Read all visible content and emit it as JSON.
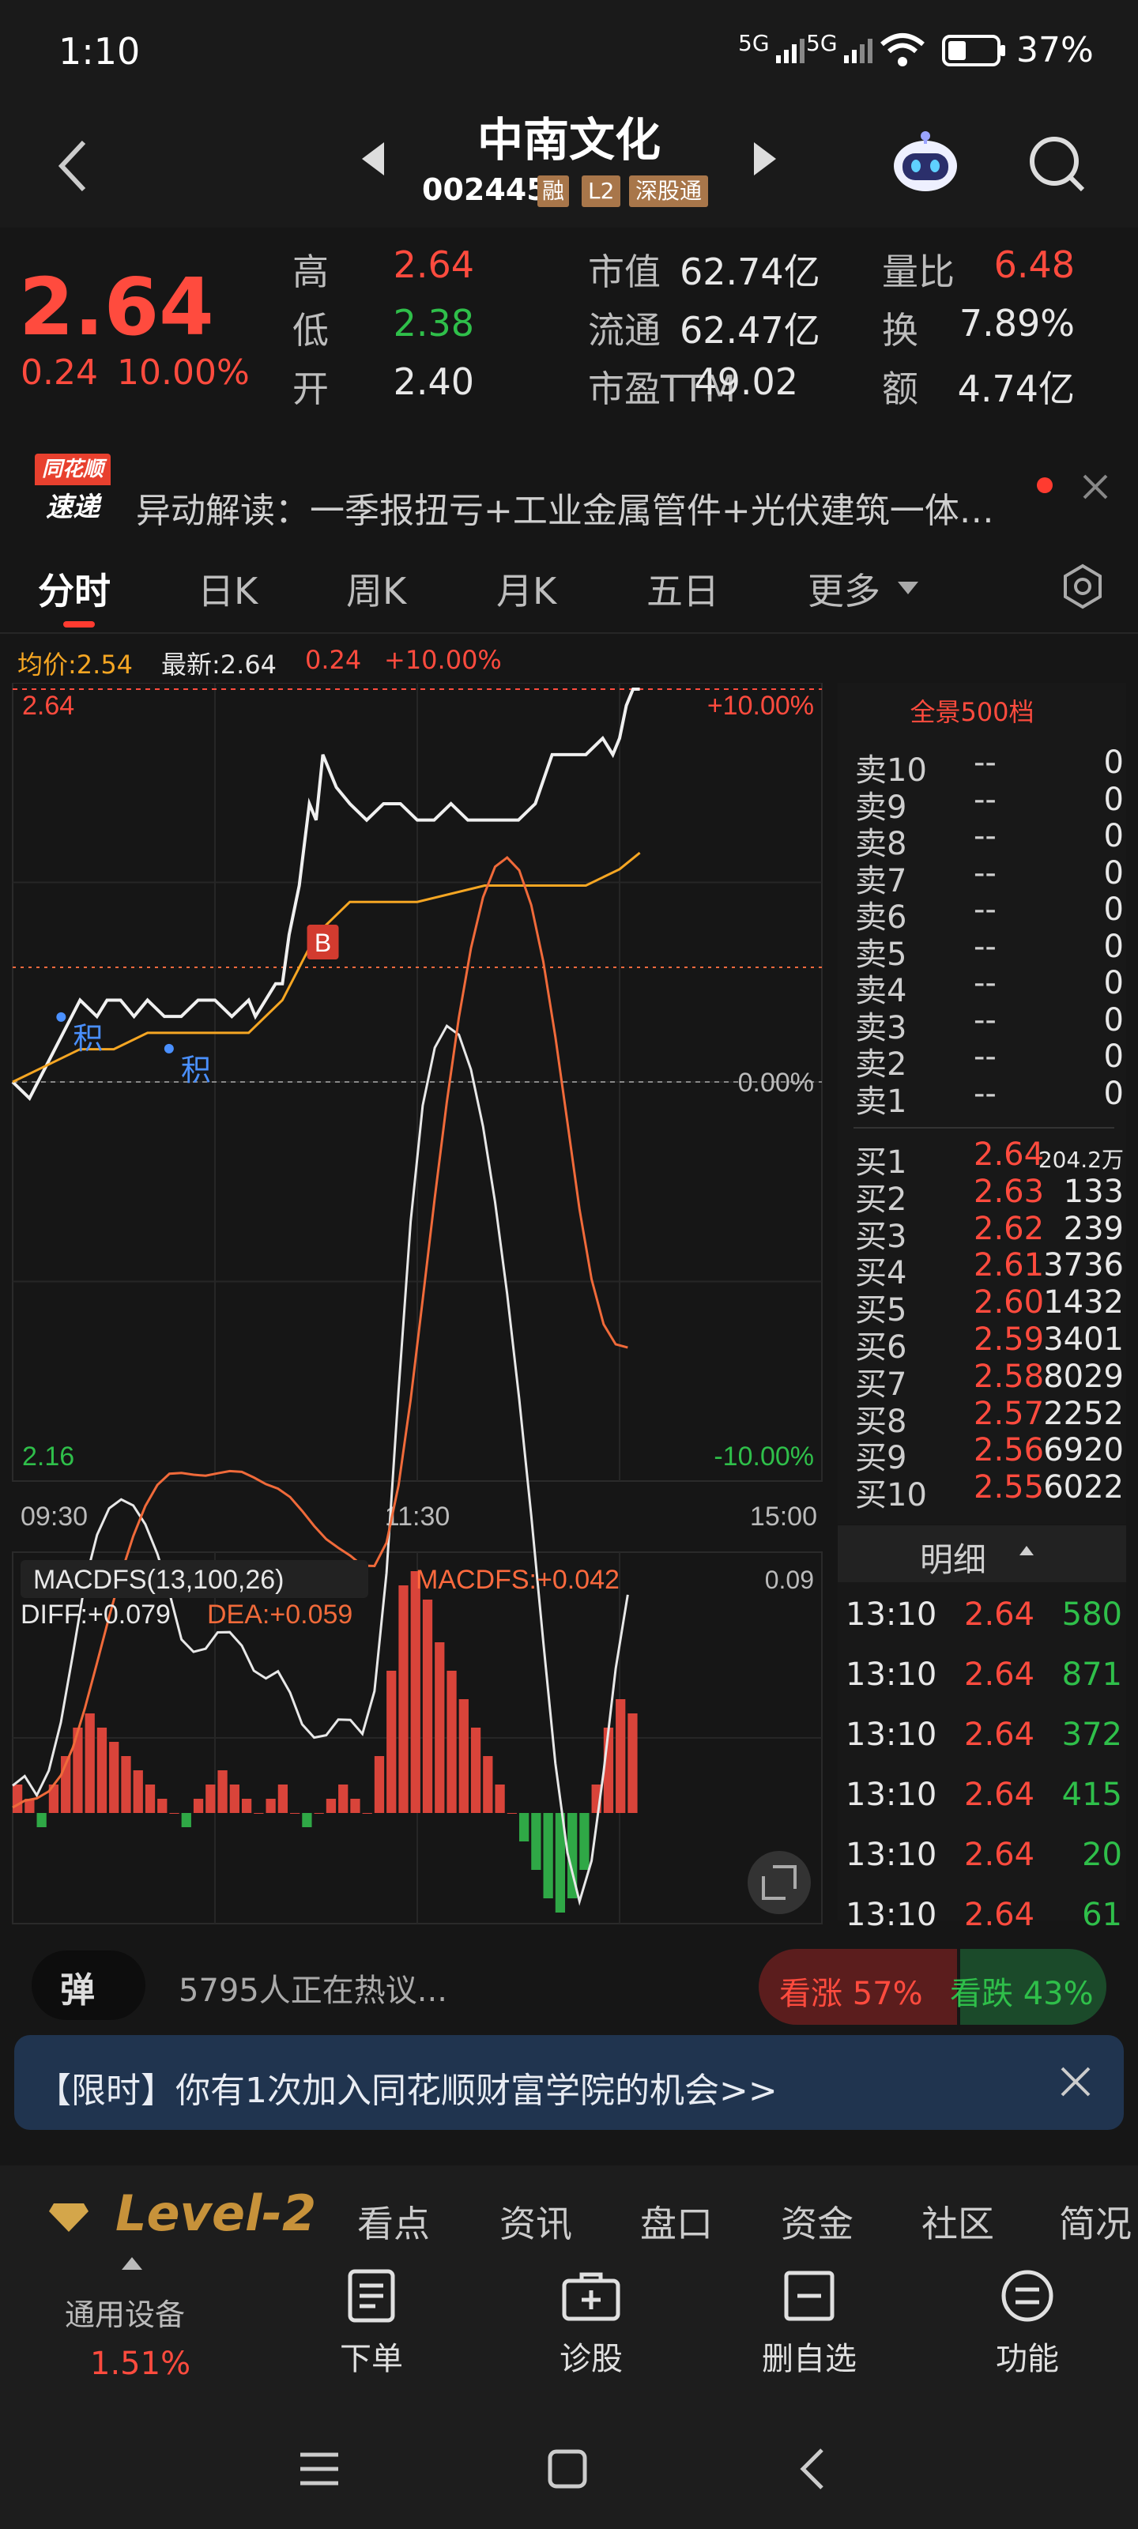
{
  "status": {
    "time": "1:10",
    "signal1": "5G",
    "signal2": "5G",
    "battery_pct": "37%"
  },
  "header": {
    "title": "中南文化",
    "code": "002445",
    "badges": [
      "融",
      "L2",
      "深股通"
    ]
  },
  "quote": {
    "price": "2.64",
    "change": "0.24",
    "change_pct": "10.00%",
    "stats": [
      {
        "label": "高",
        "value": "2.64",
        "color": "red"
      },
      {
        "label": "低",
        "value": "2.38",
        "color": "green"
      },
      {
        "label": "开",
        "value": "2.40",
        "color": "white"
      },
      {
        "label": "市值",
        "value": "62.74亿",
        "color": "white"
      },
      {
        "label": "流通",
        "value": "62.47亿",
        "color": "white"
      },
      {
        "label": "市盈TTM",
        "value": "49.02",
        "color": "white"
      },
      {
        "label": "量比",
        "value": "6.48",
        "color": "red"
      },
      {
        "label": "换",
        "value": "7.89%",
        "color": "white"
      },
      {
        "label": "额",
        "value": "4.74亿",
        "color": "white"
      }
    ]
  },
  "news": {
    "logo_top": "同花顺",
    "logo_bottom": "速递",
    "text": "异动解读：一季报扭亏+工业金属管件+光伏建筑一体…"
  },
  "tabs": [
    "分时",
    "日K",
    "周K",
    "月K",
    "五日",
    "更多"
  ],
  "chart_info": {
    "avg_label": "均价:2.54",
    "latest_label": "最新:2.64",
    "change": "0.24",
    "change_pct": "+10.00%"
  },
  "chart_data": {
    "type": "line",
    "title": "",
    "xlabel": "",
    "ylabel": "",
    "x_ticks": [
      "09:30",
      "11:30",
      "15:00"
    ],
    "y_left": {
      "top": "2.64",
      "bottom": "2.16"
    },
    "y_right": {
      "top": "+10.00%",
      "mid": "0.00%",
      "bottom": "-10.00%"
    },
    "ylim": [
      2.16,
      2.64
    ],
    "prev_close": 2.4,
    "series": [
      {
        "name": "price",
        "color": "#f0f0f0",
        "x": [
          0,
          5,
          10,
          15,
          20,
          25,
          28,
          32,
          36,
          40,
          45,
          50,
          55,
          60,
          65,
          70,
          72,
          75,
          78,
          80,
          82,
          85,
          88,
          90,
          92,
          94,
          96,
          100,
          105,
          110,
          115,
          120,
          125,
          130,
          135,
          140,
          145,
          150,
          155,
          160,
          165,
          170,
          175,
          178,
          180,
          182,
          184,
          186
        ],
        "values": [
          2.4,
          2.39,
          2.41,
          2.43,
          2.45,
          2.44,
          2.45,
          2.45,
          2.44,
          2.45,
          2.44,
          2.44,
          2.45,
          2.45,
          2.44,
          2.45,
          2.44,
          2.45,
          2.46,
          2.46,
          2.49,
          2.52,
          2.57,
          2.56,
          2.6,
          2.59,
          2.58,
          2.57,
          2.56,
          2.57,
          2.57,
          2.56,
          2.56,
          2.57,
          2.56,
          2.56,
          2.56,
          2.56,
          2.57,
          2.6,
          2.6,
          2.6,
          2.61,
          2.6,
          2.61,
          2.63,
          2.64,
          2.64
        ]
      },
      {
        "name": "avg",
        "color": "#f5a623",
        "x": [
          0,
          10,
          20,
          30,
          40,
          50,
          60,
          70,
          80,
          85,
          90,
          95,
          100,
          120,
          140,
          160,
          170,
          180,
          186
        ],
        "values": [
          2.4,
          2.41,
          2.42,
          2.42,
          2.43,
          2.43,
          2.43,
          2.43,
          2.45,
          2.47,
          2.49,
          2.5,
          2.51,
          2.51,
          2.52,
          2.52,
          2.52,
          2.53,
          2.54
        ]
      }
    ],
    "markers": [
      {
        "label": "B",
        "x": 92
      },
      {
        "label": "积",
        "x": 20
      },
      {
        "label": "积",
        "x": 52
      }
    ],
    "macd": {
      "title": "MACDFS(13,100,26)",
      "macdfs": "MACDFS:+0.042",
      "diff": "DIFF:+0.079",
      "dea": "DEA:+0.059",
      "max": "0.09",
      "bars": [
        0.01,
        0.005,
        -0.005,
        0.01,
        0.02,
        0.03,
        0.035,
        0.03,
        0.025,
        0.02,
        0.015,
        0.01,
        0.005,
        0.0,
        -0.005,
        0.005,
        0.01,
        0.015,
        0.01,
        0.005,
        0.0,
        0.005,
        0.01,
        0.0,
        -0.005,
        0.0,
        0.005,
        0.01,
        0.005,
        0.0,
        0.02,
        0.05,
        0.08,
        0.085,
        0.075,
        0.06,
        0.05,
        0.04,
        0.03,
        0.02,
        0.01,
        0.0,
        -0.01,
        -0.02,
        -0.03,
        -0.035,
        -0.03,
        -0.02,
        0.01,
        0.03,
        0.04,
        0.035
      ]
    }
  },
  "order_book": {
    "title": "全景500档",
    "asks": [
      {
        "label": "卖10",
        "price": "--",
        "vol": "0"
      },
      {
        "label": "卖9",
        "price": "--",
        "vol": "0"
      },
      {
        "label": "卖8",
        "price": "--",
        "vol": "0"
      },
      {
        "label": "卖7",
        "price": "--",
        "vol": "0"
      },
      {
        "label": "卖6",
        "price": "--",
        "vol": "0"
      },
      {
        "label": "卖5",
        "price": "--",
        "vol": "0"
      },
      {
        "label": "卖4",
        "price": "--",
        "vol": "0"
      },
      {
        "label": "卖3",
        "price": "--",
        "vol": "0"
      },
      {
        "label": "卖2",
        "price": "--",
        "vol": "0"
      },
      {
        "label": "卖1",
        "price": "--",
        "vol": "0"
      }
    ],
    "bids": [
      {
        "label": "买1",
        "price": "2.64",
        "vol": "204.2万"
      },
      {
        "label": "买2",
        "price": "2.63",
        "vol": "133"
      },
      {
        "label": "买3",
        "price": "2.62",
        "vol": "239"
      },
      {
        "label": "买4",
        "price": "2.61",
        "vol": "3736"
      },
      {
        "label": "买5",
        "price": "2.60",
        "vol": "1432"
      },
      {
        "label": "买6",
        "price": "2.59",
        "vol": "3401"
      },
      {
        "label": "买7",
        "price": "2.58",
        "vol": "8029"
      },
      {
        "label": "买8",
        "price": "2.57",
        "vol": "2252"
      },
      {
        "label": "买9",
        "price": "2.56",
        "vol": "6920"
      },
      {
        "label": "买10",
        "price": "2.55",
        "vol": "6022"
      }
    ]
  },
  "detail": {
    "title": "明细",
    "rows": [
      {
        "time": "13:10",
        "price": "2.64",
        "vol": "580"
      },
      {
        "time": "13:10",
        "price": "2.64",
        "vol": "871"
      },
      {
        "time": "13:10",
        "price": "2.64",
        "vol": "372"
      },
      {
        "time": "13:10",
        "price": "2.64",
        "vol": "415"
      },
      {
        "time": "13:10",
        "price": "2.64",
        "vol": "20"
      },
      {
        "time": "13:10",
        "price": "2.64",
        "vol": "61"
      }
    ]
  },
  "hot": {
    "badge": "弹",
    "text": "5795人正在热议...",
    "up": "看涨 57%",
    "down": "看跌 43%",
    "up_ratio": 0.57
  },
  "promo": {
    "text": "【限时】你有1次加入同花顺财富学院的机会>>"
  },
  "bottom_tabs": {
    "level2": "Level-2",
    "items": [
      "看点",
      "资讯",
      "盘口",
      "资金",
      "社区",
      "简况"
    ]
  },
  "toolbar": {
    "device_label": "通用设备",
    "device_pct": "1.51%",
    "items": [
      "下单",
      "诊股",
      "删自选",
      "功能"
    ]
  }
}
